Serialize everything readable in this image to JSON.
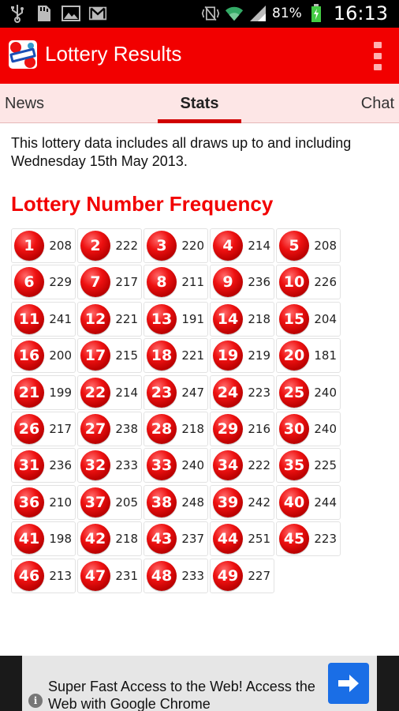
{
  "status_bar": {
    "battery_percent": "81%",
    "time": "16:13",
    "icons": [
      "usb-icon",
      "sd-card-icon",
      "image-icon",
      "gmail-icon",
      "vibrate-icon",
      "wifi-icon",
      "signal-icon",
      "battery-icon"
    ]
  },
  "app": {
    "title": "Lottery Results",
    "logo_icon": "lottery-results-logo",
    "menu_icon": "overflow-menu-icon",
    "accent_color": "#f20000"
  },
  "tabs": [
    {
      "label": "News",
      "selected": false
    },
    {
      "label": "Stats",
      "selected": true
    },
    {
      "label": "Chat",
      "selected": false
    }
  ],
  "intro_text": "This lottery data includes all draws up to and including Wednesday 15th May 2013.",
  "section_title": "Lottery Number Frequency",
  "frequency": [
    {
      "number": "1",
      "count": "208"
    },
    {
      "number": "2",
      "count": "222"
    },
    {
      "number": "3",
      "count": "220"
    },
    {
      "number": "4",
      "count": "214"
    },
    {
      "number": "5",
      "count": "208"
    },
    {
      "number": "6",
      "count": "229"
    },
    {
      "number": "7",
      "count": "217"
    },
    {
      "number": "8",
      "count": "211"
    },
    {
      "number": "9",
      "count": "236"
    },
    {
      "number": "10",
      "count": "226"
    },
    {
      "number": "11",
      "count": "241"
    },
    {
      "number": "12",
      "count": "221"
    },
    {
      "number": "13",
      "count": "191"
    },
    {
      "number": "14",
      "count": "218"
    },
    {
      "number": "15",
      "count": "204"
    },
    {
      "number": "16",
      "count": "200"
    },
    {
      "number": "17",
      "count": "215"
    },
    {
      "number": "18",
      "count": "221"
    },
    {
      "number": "19",
      "count": "219"
    },
    {
      "number": "20",
      "count": "181"
    },
    {
      "number": "21",
      "count": "199"
    },
    {
      "number": "22",
      "count": "214"
    },
    {
      "number": "23",
      "count": "247"
    },
    {
      "number": "24",
      "count": "223"
    },
    {
      "number": "25",
      "count": "240"
    },
    {
      "number": "26",
      "count": "217"
    },
    {
      "number": "27",
      "count": "238"
    },
    {
      "number": "28",
      "count": "218"
    },
    {
      "number": "29",
      "count": "216"
    },
    {
      "number": "30",
      "count": "240"
    },
    {
      "number": "31",
      "count": "236"
    },
    {
      "number": "32",
      "count": "233"
    },
    {
      "number": "33",
      "count": "240"
    },
    {
      "number": "34",
      "count": "222"
    },
    {
      "number": "35",
      "count": "225"
    },
    {
      "number": "36",
      "count": "210"
    },
    {
      "number": "37",
      "count": "205"
    },
    {
      "number": "38",
      "count": "248"
    },
    {
      "number": "39",
      "count": "242"
    },
    {
      "number": "40",
      "count": "244"
    },
    {
      "number": "41",
      "count": "198"
    },
    {
      "number": "42",
      "count": "218"
    },
    {
      "number": "43",
      "count": "237"
    },
    {
      "number": "44",
      "count": "251"
    },
    {
      "number": "45",
      "count": "223"
    },
    {
      "number": "46",
      "count": "213"
    },
    {
      "number": "47",
      "count": "231"
    },
    {
      "number": "48",
      "count": "233"
    },
    {
      "number": "49",
      "count": "227"
    }
  ],
  "ad": {
    "text": "Super Fast Access to the Web! Access the Web with Google Chrome",
    "info_icon": "info-icon",
    "arrow_icon": "arrow-right-icon",
    "arrow_color": "#1a6ee6"
  }
}
